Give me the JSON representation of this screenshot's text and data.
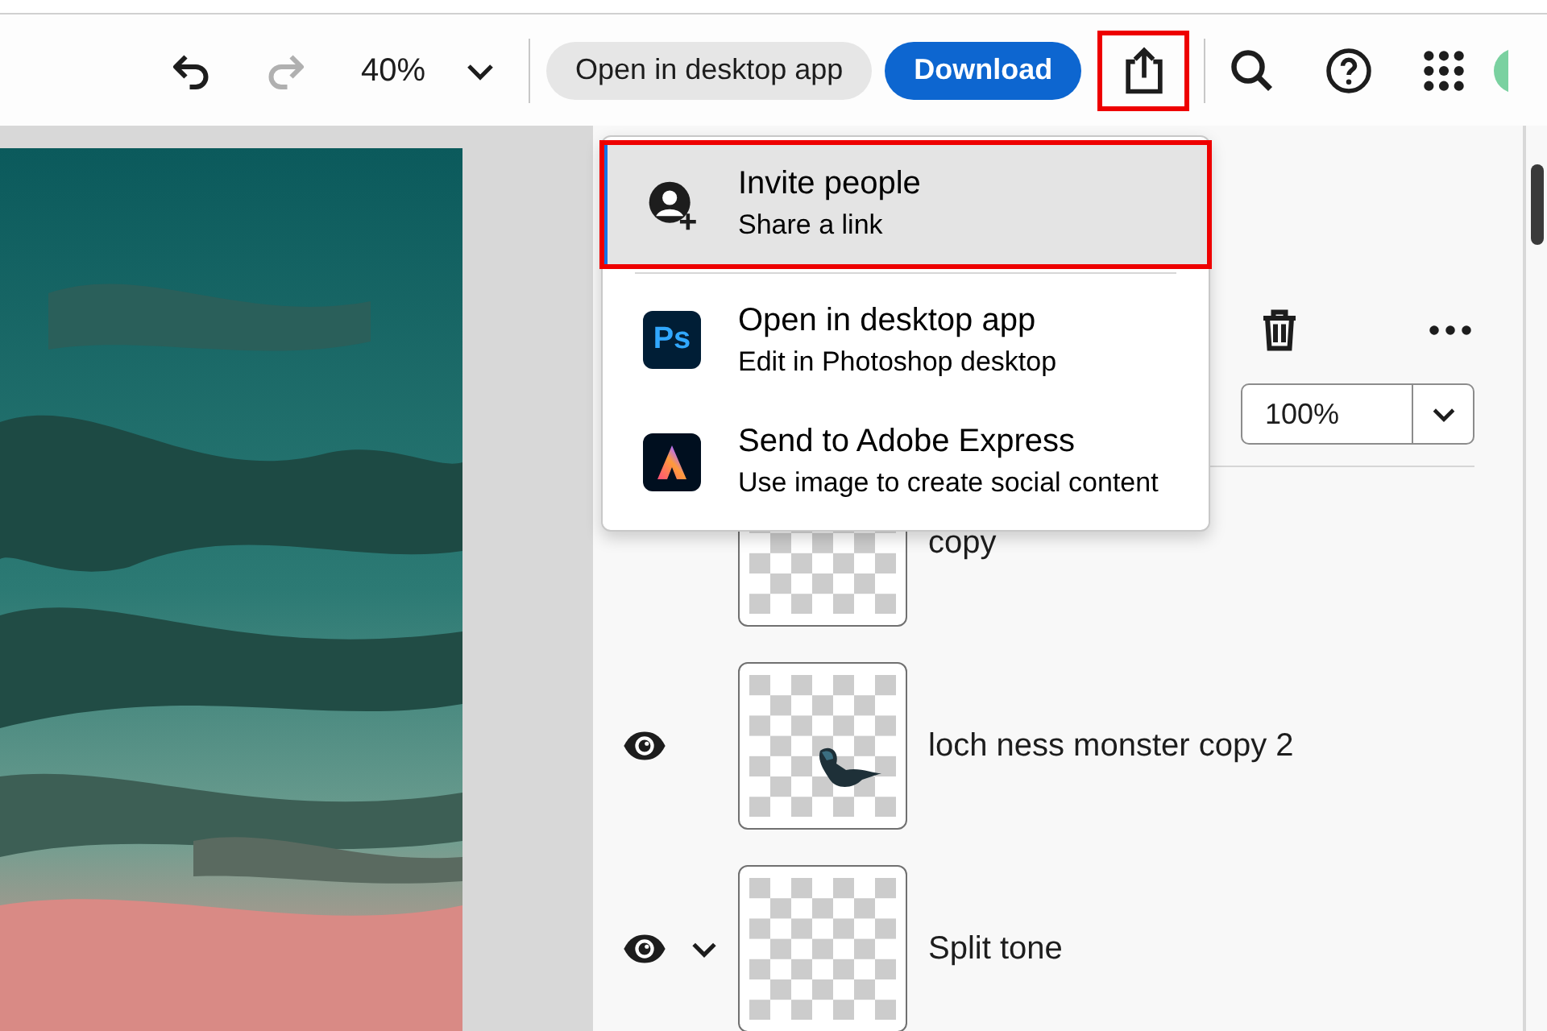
{
  "toolbar": {
    "undo": {
      "disabled": false
    },
    "redo": {
      "disabled": true
    },
    "zoom": "40%",
    "open_button": "Open in desktop app",
    "download_button": "Download",
    "share": {
      "highlighted": true
    }
  },
  "share_menu": [
    {
      "kind": "invite",
      "title": "Invite people",
      "subtitle": "Share a link",
      "selected": true,
      "highlighted": true
    },
    {
      "kind": "photoshop",
      "icon_text": "Ps",
      "title": "Open in desktop app",
      "subtitle": "Edit in Photoshop desktop",
      "selected": false,
      "highlighted": false
    },
    {
      "kind": "express",
      "title": "Send to Adobe Express",
      "subtitle": "Use image to create social content",
      "selected": false,
      "highlighted": false
    }
  ],
  "layers_panel": {
    "opacity": "100%",
    "layers": [
      {
        "kind": "layer",
        "name": "copy",
        "has_picture": false
      },
      {
        "kind": "layer",
        "name": "loch ness monster copy 2",
        "visible": true,
        "has_picture": true
      },
      {
        "kind": "group",
        "name": "Split tone",
        "visible": true,
        "expanded": true,
        "has_picture": false
      }
    ]
  }
}
